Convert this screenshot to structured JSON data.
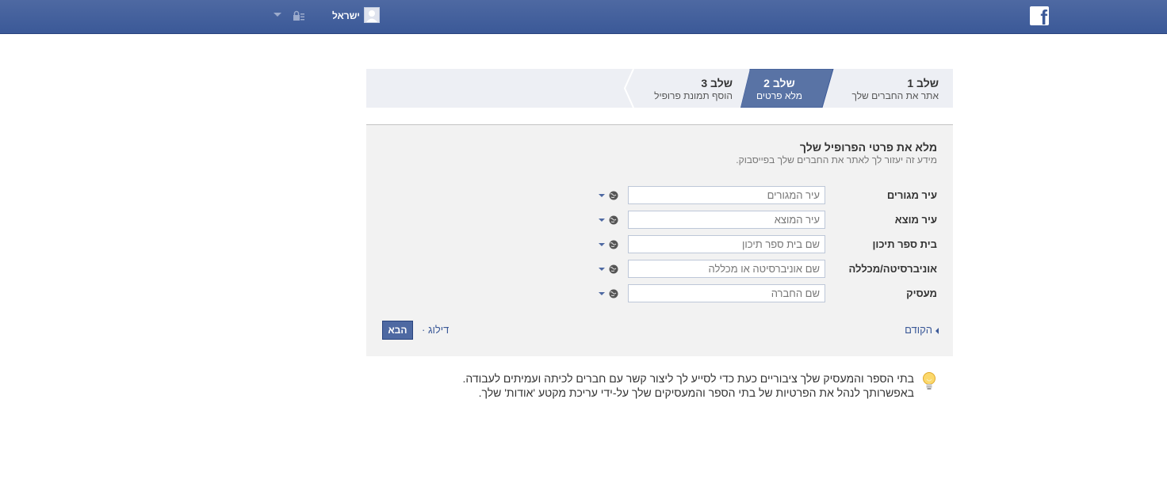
{
  "topbar": {
    "logo_letter": "f",
    "username": "ישראל",
    "brand_color": "#3b5998"
  },
  "steps": [
    {
      "title": "שלב 1",
      "subtitle": "אתר את החברים שלך",
      "active": false
    },
    {
      "title": "שלב 2",
      "subtitle": "מלא פרטים",
      "active": true
    },
    {
      "title": "שלב 3",
      "subtitle": "הוסף תמונת פרופיל",
      "active": false
    }
  ],
  "form": {
    "title": "מלא את פרטי הפרופיל שלך",
    "subtitle": "מידע זה יעזור לך לאתר את החברים שלך בפייסבוק.",
    "fields": [
      {
        "label": "עיר מגורים",
        "placeholder": "עיר המגורים"
      },
      {
        "label": "עיר מוצא",
        "placeholder": "עיר המוצא"
      },
      {
        "label": "בית ספר תיכון",
        "placeholder": "שם בית ספר תיכון"
      },
      {
        "label": "אוניברסיטה/מכללה",
        "placeholder": "שם אוניברסיטה או מכללה"
      },
      {
        "label": "מעסיק",
        "placeholder": "שם החברה"
      }
    ],
    "prev_label": "הקודם",
    "skip_label": "דילוג ·",
    "next_label": "הבא"
  },
  "tip": {
    "line1": "בתי הספר והמעסיק שלך ציבוריים כעת כדי לסייע לך ליצור קשר עם חברים לכיתה ועמיתים לעבודה.",
    "line2": "באפשרותך לנהל את הפרטיות של בתי הספר והמעסיקים שלך על-ידי עריכת מקטע 'אודות' שלך."
  }
}
